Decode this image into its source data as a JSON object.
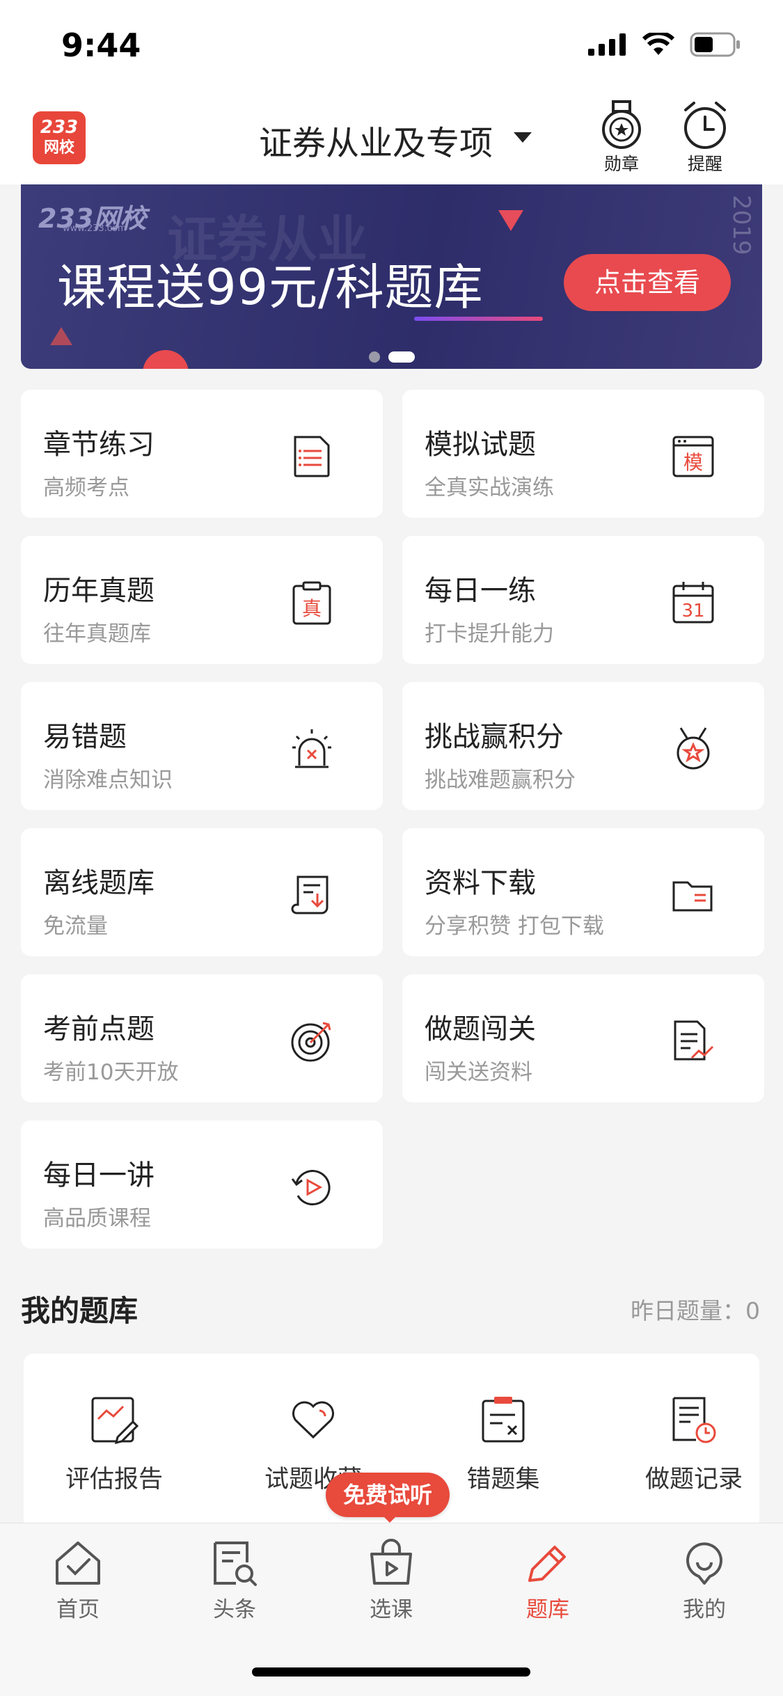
{
  "status_bar": {
    "time": "9:44"
  },
  "header": {
    "logo_top": "233",
    "logo_bottom": "网校",
    "title": "证券从业及专项",
    "medal_label": "勋章",
    "reminder_label": "提醒"
  },
  "banner": {
    "brand": "233网校",
    "brand_url": "www.233.com",
    "bg_text": "证券从业",
    "year": "2019",
    "headline": "课程送99元/科题库",
    "cta": "点击查看"
  },
  "features": [
    {
      "title": "章节练习",
      "subtitle": "高频考点"
    },
    {
      "title": "模拟试题",
      "subtitle": "全真实战演练",
      "icon_text": "模"
    },
    {
      "title": "历年真题",
      "subtitle": "往年真题库",
      "icon_text": "真"
    },
    {
      "title": "每日一练",
      "subtitle": "打卡提升能力",
      "icon_text": "31"
    },
    {
      "title": "易错题",
      "subtitle": "消除难点知识"
    },
    {
      "title": "挑战赢积分",
      "subtitle": "挑战难题赢积分"
    },
    {
      "title": "离线题库",
      "subtitle": "免流量"
    },
    {
      "title": "资料下载",
      "subtitle": "分享积赞 打包下载"
    },
    {
      "title": "考前点题",
      "subtitle": "考前10天开放"
    },
    {
      "title": "做题闯关",
      "subtitle": "闯关送资料"
    },
    {
      "title": "每日一讲",
      "subtitle": "高品质课程"
    }
  ],
  "my_bank": {
    "title": "我的题库",
    "yesterday": "昨日题量：0",
    "items": [
      {
        "label": "评估报告"
      },
      {
        "label": "试题收藏"
      },
      {
        "label": "错题集"
      },
      {
        "label": "做题记录"
      }
    ]
  },
  "trial_badge": "免费试听",
  "tabs": [
    {
      "label": "首页"
    },
    {
      "label": "头条"
    },
    {
      "label": "选课"
    },
    {
      "label": "题库"
    },
    {
      "label": "我的"
    }
  ],
  "colors": {
    "accent": "#e84a3c",
    "banner_bg": "#2e2d6a",
    "page_bg": "#f4f4f5"
  }
}
